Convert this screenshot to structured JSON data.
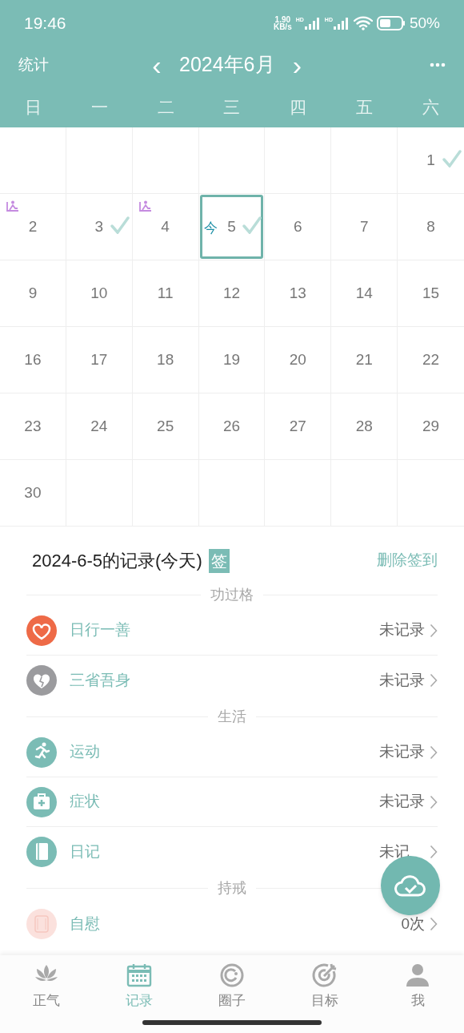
{
  "status_bar": {
    "time": "19:46",
    "speed": "1.90",
    "speed_unit": "KB/s",
    "network_labels": [
      "HD",
      "HD"
    ],
    "battery": "50%"
  },
  "header": {
    "left": "统计",
    "prev": "‹",
    "title": "2024年6月",
    "next": "›"
  },
  "weekdays": [
    "日",
    "一",
    "二",
    "三",
    "四",
    "五",
    "六"
  ],
  "calendar": [
    {
      "kind": "empty"
    },
    {
      "kind": "empty"
    },
    {
      "kind": "empty"
    },
    {
      "kind": "empty"
    },
    {
      "kind": "empty"
    },
    {
      "kind": "empty"
    },
    {
      "kind": "day",
      "day": "1",
      "checked": true,
      "marked": false,
      "today": false
    },
    {
      "kind": "day",
      "day": "2",
      "checked": false,
      "marked": true,
      "today": false
    },
    {
      "kind": "day",
      "day": "3",
      "checked": true,
      "marked": false,
      "today": false
    },
    {
      "kind": "day",
      "day": "4",
      "checked": false,
      "marked": true,
      "today": false
    },
    {
      "kind": "day",
      "day": "5",
      "checked": true,
      "marked": false,
      "today": true,
      "today_label": "今"
    },
    {
      "kind": "day",
      "day": "6",
      "checked": false,
      "marked": false,
      "today": false
    },
    {
      "kind": "day",
      "day": "7",
      "checked": false,
      "marked": false,
      "today": false
    },
    {
      "kind": "day",
      "day": "8",
      "checked": false,
      "marked": false,
      "today": false
    },
    {
      "kind": "day",
      "day": "9",
      "checked": false,
      "marked": false,
      "today": false
    },
    {
      "kind": "day",
      "day": "10",
      "checked": false,
      "marked": false,
      "today": false
    },
    {
      "kind": "day",
      "day": "11",
      "checked": false,
      "marked": false,
      "today": false
    },
    {
      "kind": "day",
      "day": "12",
      "checked": false,
      "marked": false,
      "today": false
    },
    {
      "kind": "day",
      "day": "13",
      "checked": false,
      "marked": false,
      "today": false
    },
    {
      "kind": "day",
      "day": "14",
      "checked": false,
      "marked": false,
      "today": false
    },
    {
      "kind": "day",
      "day": "15",
      "checked": false,
      "marked": false,
      "today": false
    },
    {
      "kind": "day",
      "day": "16",
      "checked": false,
      "marked": false,
      "today": false
    },
    {
      "kind": "day",
      "day": "17",
      "checked": false,
      "marked": false,
      "today": false
    },
    {
      "kind": "day",
      "day": "18",
      "checked": false,
      "marked": false,
      "today": false
    },
    {
      "kind": "day",
      "day": "19",
      "checked": false,
      "marked": false,
      "today": false
    },
    {
      "kind": "day",
      "day": "20",
      "checked": false,
      "marked": false,
      "today": false
    },
    {
      "kind": "day",
      "day": "21",
      "checked": false,
      "marked": false,
      "today": false
    },
    {
      "kind": "day",
      "day": "22",
      "checked": false,
      "marked": false,
      "today": false
    },
    {
      "kind": "day",
      "day": "23",
      "checked": false,
      "marked": false,
      "today": false
    },
    {
      "kind": "day",
      "day": "24",
      "checked": false,
      "marked": false,
      "today": false
    },
    {
      "kind": "day",
      "day": "25",
      "checked": false,
      "marked": false,
      "today": false
    },
    {
      "kind": "day",
      "day": "26",
      "checked": false,
      "marked": false,
      "today": false
    },
    {
      "kind": "day",
      "day": "27",
      "checked": false,
      "marked": false,
      "today": false
    },
    {
      "kind": "day",
      "day": "28",
      "checked": false,
      "marked": false,
      "today": false
    },
    {
      "kind": "day",
      "day": "29",
      "checked": false,
      "marked": false,
      "today": false
    },
    {
      "kind": "day",
      "day": "30",
      "checked": false,
      "marked": false,
      "today": false
    },
    {
      "kind": "empty"
    },
    {
      "kind": "empty"
    },
    {
      "kind": "empty"
    },
    {
      "kind": "empty"
    },
    {
      "kind": "empty"
    },
    {
      "kind": "empty"
    }
  ],
  "record": {
    "title": "2024-6-5的记录(今天)",
    "badge": "签",
    "action": "删除签到",
    "sections": [
      {
        "title": "功过格",
        "items": [
          {
            "kind": "heart",
            "color": "#ee6a47",
            "label": "日行一善",
            "value": "未记录"
          },
          {
            "kind": "broken_heart",
            "color": "#9b9b9e",
            "label": "三省吾身",
            "value": "未记录"
          }
        ]
      },
      {
        "title": "生活",
        "items": [
          {
            "kind": "running",
            "color": "#7bbcb5",
            "label": "运动",
            "value": "未记录"
          },
          {
            "kind": "medkit",
            "color": "#7bbcb5",
            "label": "症状",
            "value": "未记录"
          },
          {
            "kind": "notebook",
            "color": "#7bbcb5",
            "label": "日记",
            "value": "未记"
          }
        ]
      },
      {
        "title": "持戒",
        "items": [
          {
            "kind": "tissue",
            "color": "#fbe1dd",
            "label": "自慰",
            "value": "0次"
          }
        ]
      }
    ]
  },
  "tabs": [
    {
      "kind": "lotus",
      "label": "正气",
      "selected": false
    },
    {
      "kind": "calendar",
      "label": "记录",
      "selected": true
    },
    {
      "kind": "circle",
      "label": "圈子",
      "selected": false
    },
    {
      "kind": "target",
      "label": "目标",
      "selected": false
    },
    {
      "kind": "person",
      "label": "我",
      "selected": false
    }
  ]
}
